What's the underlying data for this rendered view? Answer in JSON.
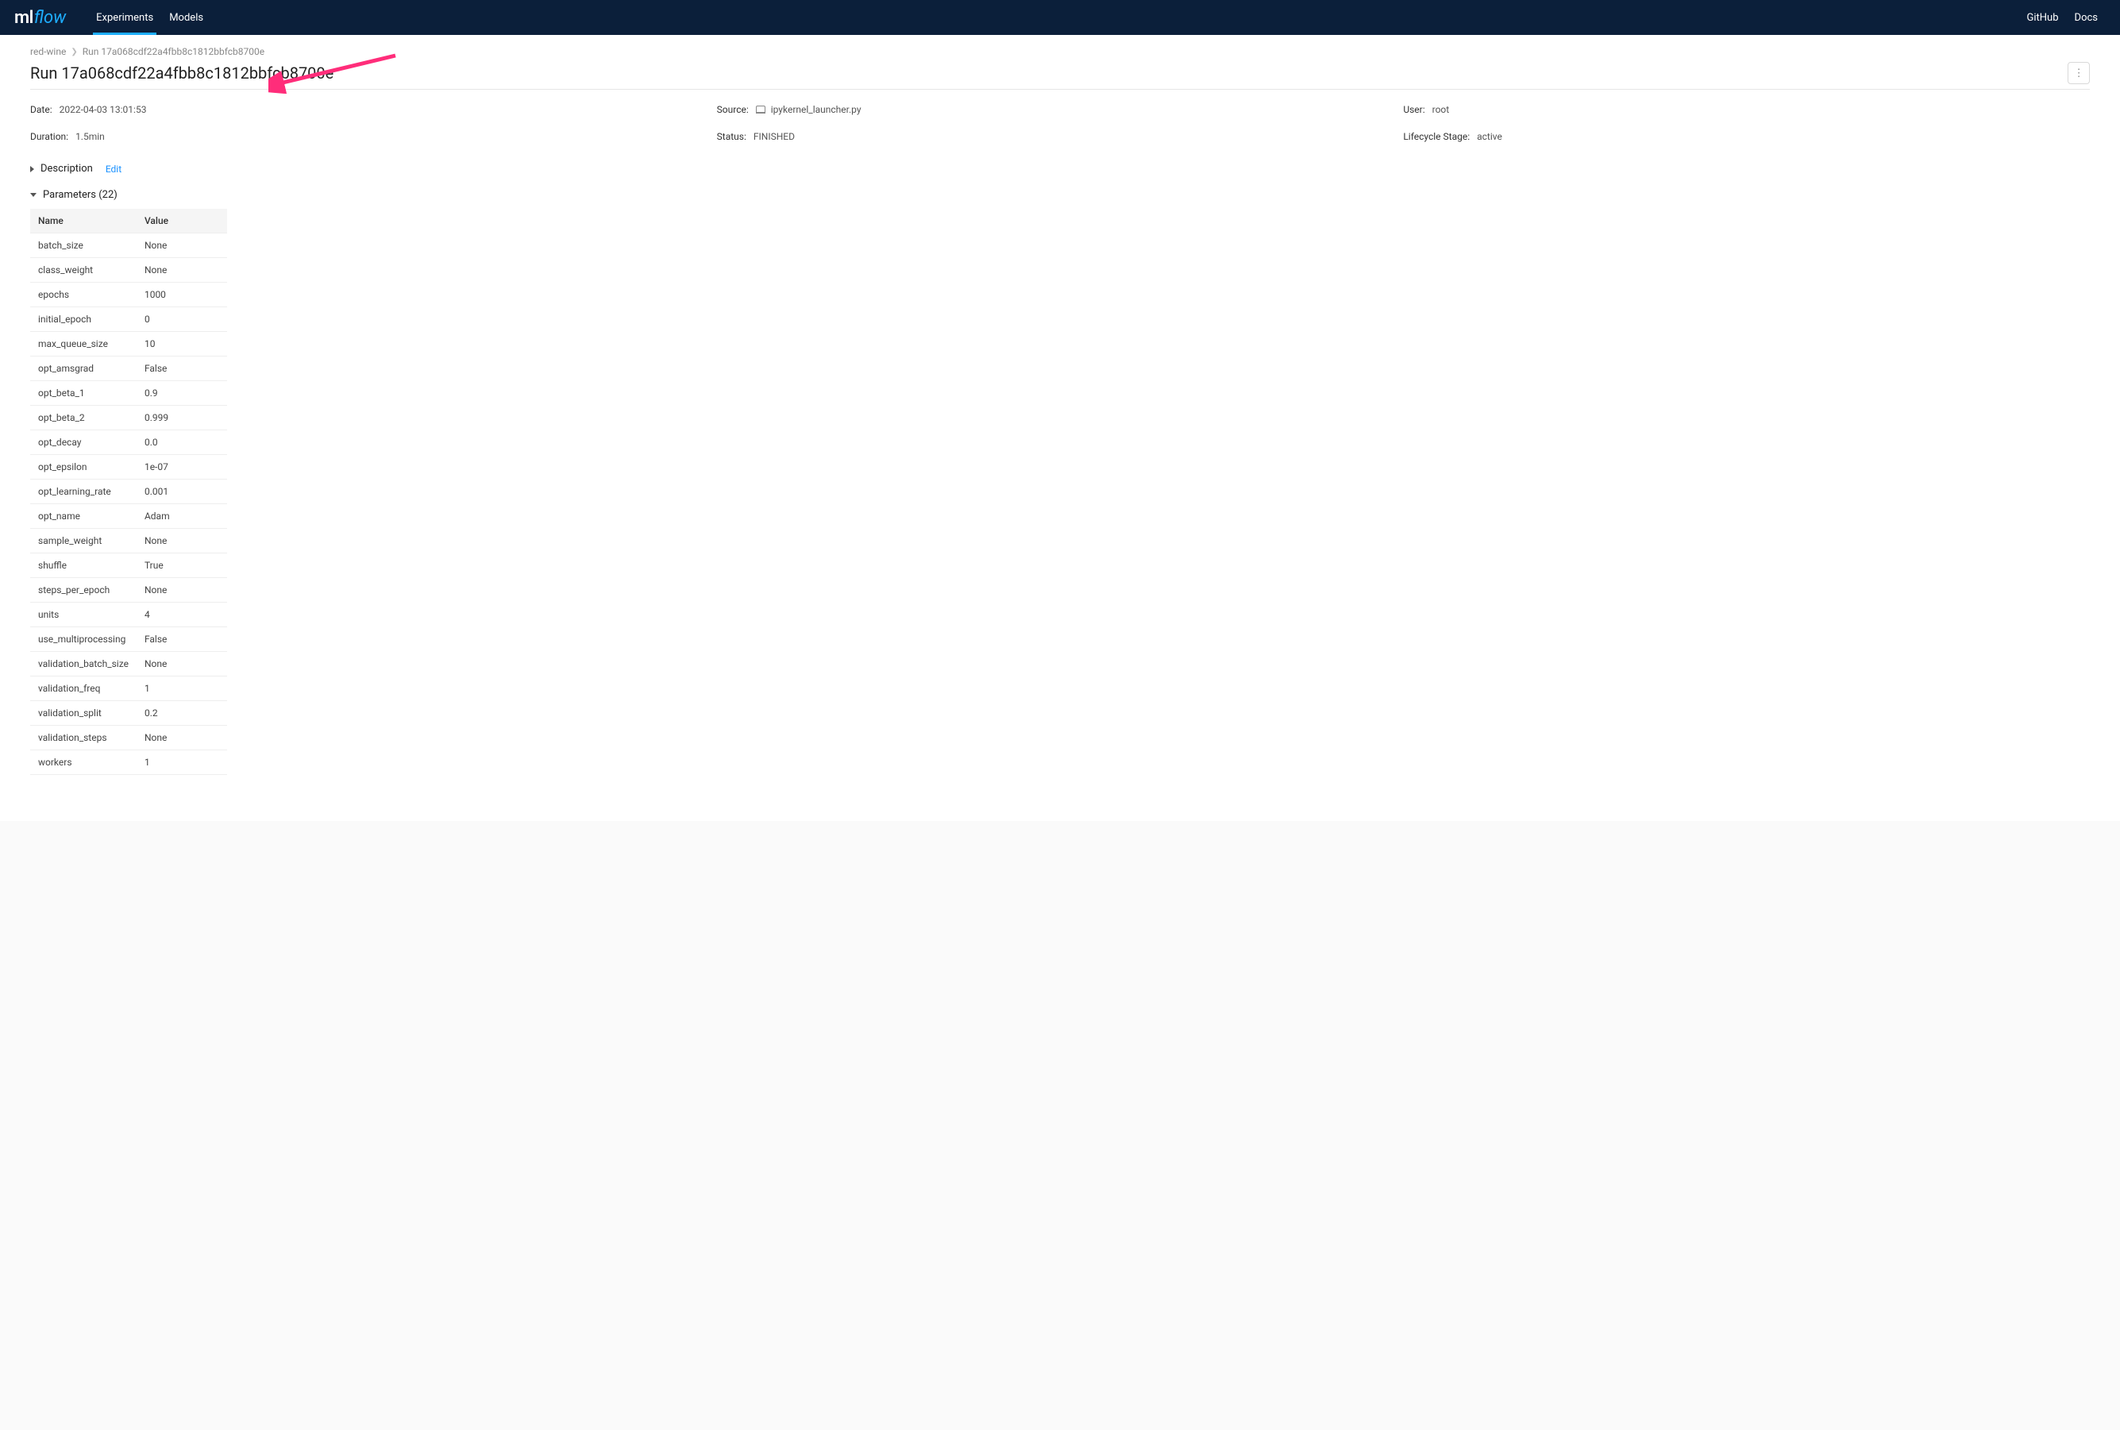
{
  "nav": {
    "logo_ml": "ml",
    "logo_flow": "flow",
    "experiments": "Experiments",
    "models": "Models",
    "github": "GitHub",
    "docs": "Docs"
  },
  "breadcrumb": {
    "parent": "red-wine",
    "current": "Run 17a068cdf22a4fbb8c1812bbfcb8700e"
  },
  "title": "Run 17a068cdf22a4fbb8c1812bbfcb8700e",
  "info": {
    "date_label": "Date",
    "date_value": "2022-04-03 13:01:53",
    "source_label": "Source",
    "source_value": "ipykernel_launcher.py",
    "user_label": "User",
    "user_value": "root",
    "duration_label": "Duration",
    "duration_value": "1.5min",
    "status_label": "Status",
    "status_value": "FINISHED",
    "lifecycle_label": "Lifecycle Stage",
    "lifecycle_value": "active"
  },
  "sections": {
    "description_label": "Description",
    "edit_label": "Edit",
    "parameters_label": "Parameters (22)"
  },
  "params_headers": {
    "name": "Name",
    "value": "Value"
  },
  "params": [
    {
      "name": "batch_size",
      "value": "None"
    },
    {
      "name": "class_weight",
      "value": "None"
    },
    {
      "name": "epochs",
      "value": "1000"
    },
    {
      "name": "initial_epoch",
      "value": "0"
    },
    {
      "name": "max_queue_size",
      "value": "10"
    },
    {
      "name": "opt_amsgrad",
      "value": "False"
    },
    {
      "name": "opt_beta_1",
      "value": "0.9"
    },
    {
      "name": "opt_beta_2",
      "value": "0.999"
    },
    {
      "name": "opt_decay",
      "value": "0.0"
    },
    {
      "name": "opt_epsilon",
      "value": "1e-07"
    },
    {
      "name": "opt_learning_rate",
      "value": "0.001"
    },
    {
      "name": "opt_name",
      "value": "Adam"
    },
    {
      "name": "sample_weight",
      "value": "None"
    },
    {
      "name": "shuffle",
      "value": "True"
    },
    {
      "name": "steps_per_epoch",
      "value": "None"
    },
    {
      "name": "units",
      "value": "4"
    },
    {
      "name": "use_multiprocessing",
      "value": "False"
    },
    {
      "name": "validation_batch_size",
      "value": "None"
    },
    {
      "name": "validation_freq",
      "value": "1"
    },
    {
      "name": "validation_split",
      "value": "0.2"
    },
    {
      "name": "validation_steps",
      "value": "None"
    },
    {
      "name": "workers",
      "value": "1"
    }
  ]
}
